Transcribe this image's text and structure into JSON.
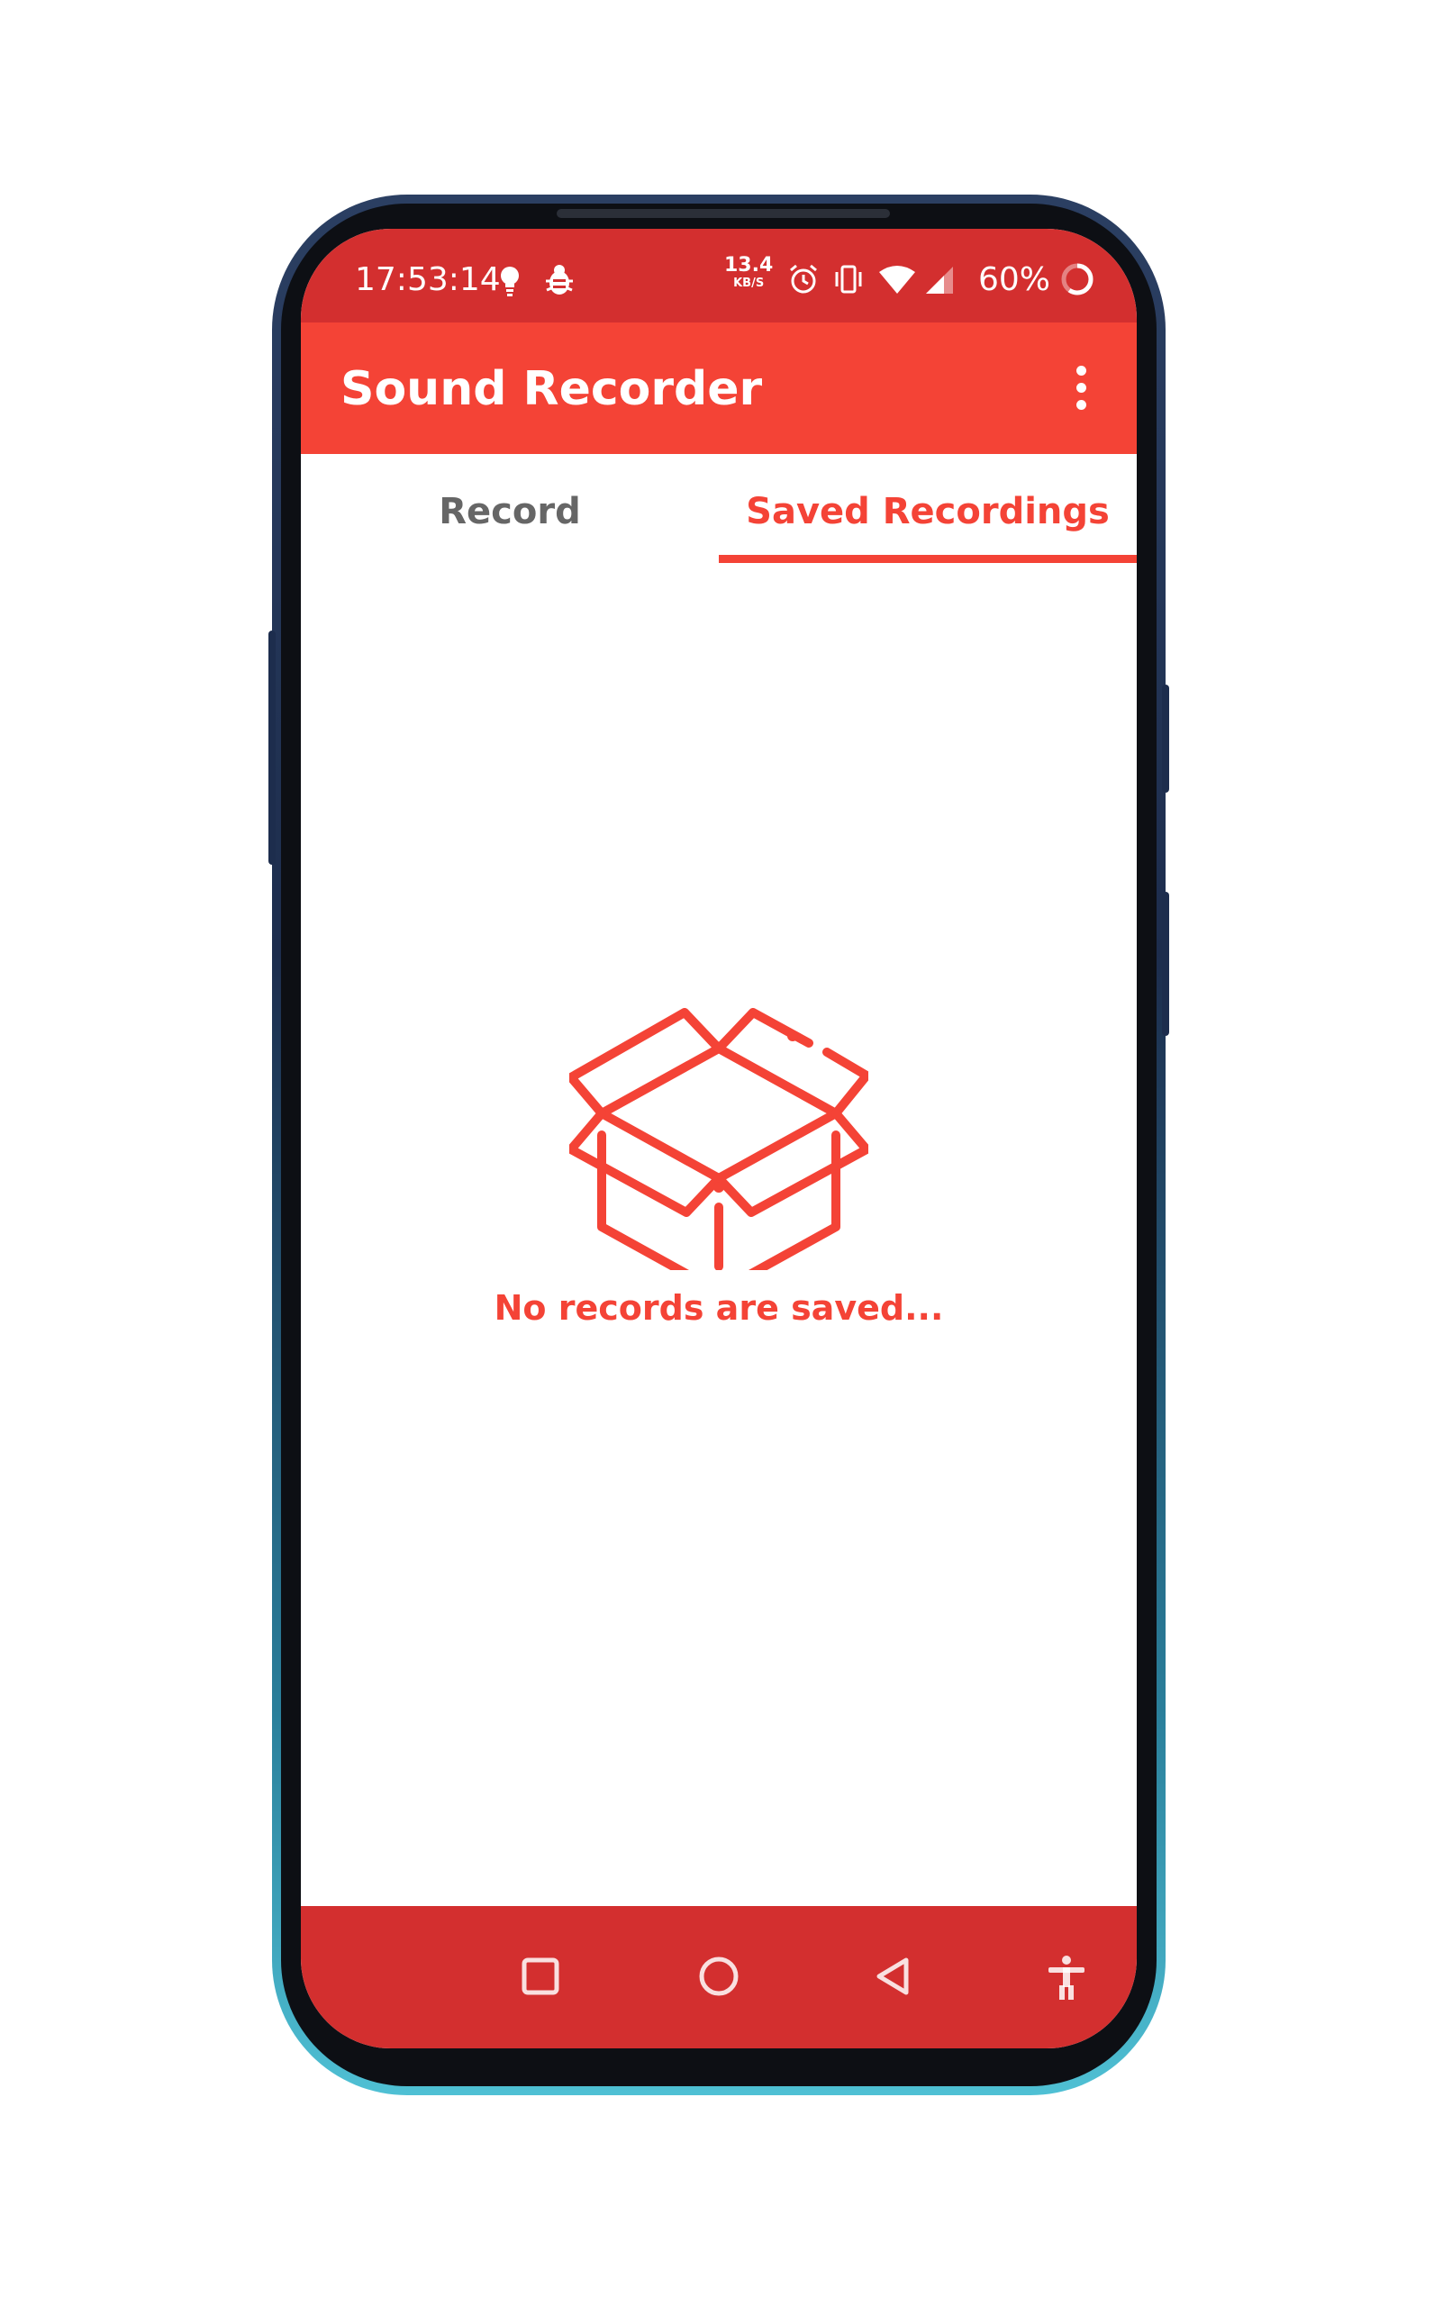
{
  "status_bar": {
    "time": "17:53:14",
    "net_speed_value": "13.4",
    "net_speed_unit": "KB/S",
    "battery": "60%",
    "icons": [
      "lightbulb-icon",
      "bug-icon",
      "alarm-icon",
      "vibrate-icon",
      "wifi-icon",
      "signal-icon",
      "battery-ring-icon"
    ]
  },
  "app_bar": {
    "title": "Sound Recorder",
    "menu_icon": "more-vert-icon"
  },
  "tabs": [
    {
      "label": "Record",
      "selected": false
    },
    {
      "label": "Saved Recordings",
      "selected": true
    }
  ],
  "empty_state": {
    "icon": "open-box-icon",
    "message": "No records are saved..."
  },
  "nav_bar": {
    "buttons": [
      "recents-square-icon",
      "home-circle-icon",
      "back-triangle-icon",
      "accessibility-icon"
    ]
  },
  "colors": {
    "status_bar": "#d32f2f",
    "accent": "#f44336",
    "tab_inactive": "#666666",
    "nav_bar": "#d32f2f"
  }
}
